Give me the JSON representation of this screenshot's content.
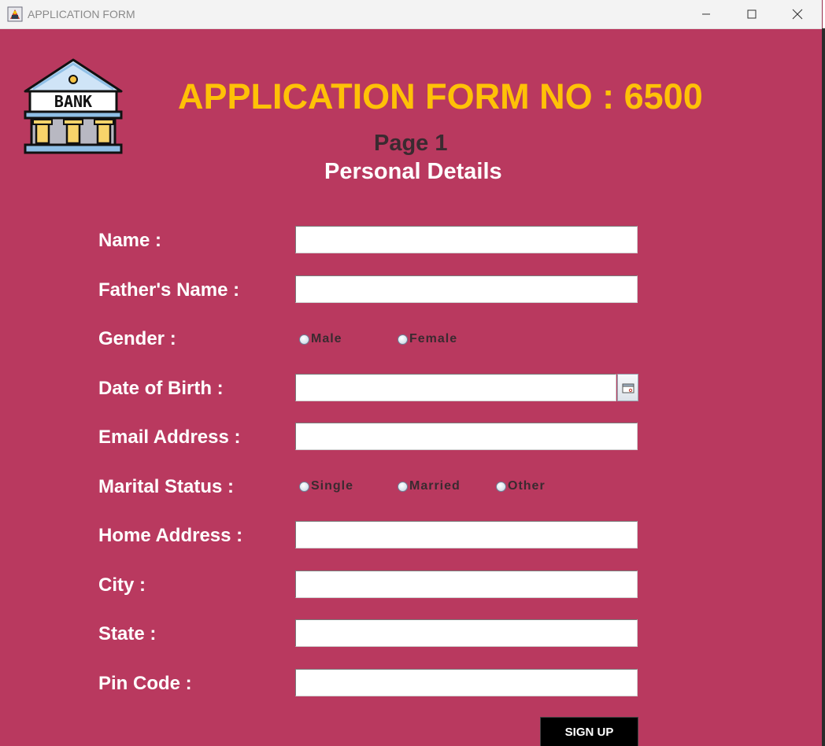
{
  "window": {
    "title": "APPLICATION FORM",
    "controls": [
      "minimize-icon",
      "maximize-icon",
      "close-icon"
    ]
  },
  "header": {
    "logo_text": "BANK",
    "title": "APPLICATION FORM NO : 6500",
    "page": "Page 1",
    "section": "Personal Details"
  },
  "form": {
    "name_label": "Name :",
    "name_value": "",
    "father_label": "Father's Name :",
    "father_value": "",
    "gender_label": "Gender :",
    "gender_options": [
      "Male",
      "Female"
    ],
    "dob_label": "Date of Birth :",
    "dob_value": "",
    "email_label": "Email Address :",
    "email_value": "",
    "marital_label": "Marital Status :",
    "marital_options": [
      "Single",
      "Married",
      "Other"
    ],
    "address_label": "Home Address :",
    "address_value": "",
    "city_label": "City :",
    "city_value": "",
    "state_label": "State :",
    "state_value": "",
    "pin_label": "Pin Code :",
    "pin_value": ""
  },
  "actions": {
    "signup_label": "SIGN UP"
  },
  "colors": {
    "background": "#b9395f",
    "title": "#ffc107",
    "label": "#ffffff",
    "button": "#000000"
  }
}
